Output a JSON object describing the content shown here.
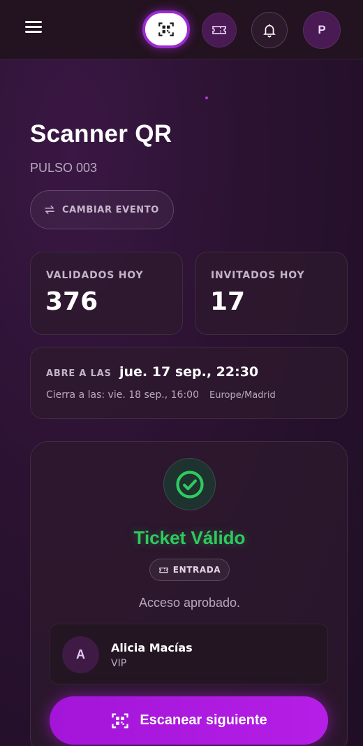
{
  "header": {
    "menu_icon": "menu-icon",
    "qr_icon": "qr-code-icon",
    "ticket_icon": "ticket-icon",
    "bell_icon": "bell-icon",
    "avatar_initial": "P"
  },
  "page": {
    "title": "Scanner QR",
    "event_code": "PULSO 003",
    "change_event_label": "CAMBIAR EVENTO"
  },
  "stats": {
    "validated_label": "VALIDADOS HOY",
    "validated_value": "376",
    "invited_label": "INVITADOS HOY",
    "invited_value": "17"
  },
  "schedule": {
    "opens_label": "ABRE A LAS",
    "opens_value": "jue. 17 sep., 22:30",
    "closes_text": "Cierra a las: vie. 18 sep., 16:00",
    "timezone": "Europe/Madrid"
  },
  "result": {
    "status_title": "Ticket Válido",
    "ticket_type": "ENTRADA",
    "message": "Acceso aprobado.",
    "guest_initial": "A",
    "guest_name": "Alicia Macías",
    "guest_category": "VIP",
    "scan_next_label": "Escanear siguiente"
  },
  "colors": {
    "accent": "#a315d8",
    "success": "#2fca5e",
    "background": "#2a1230"
  }
}
